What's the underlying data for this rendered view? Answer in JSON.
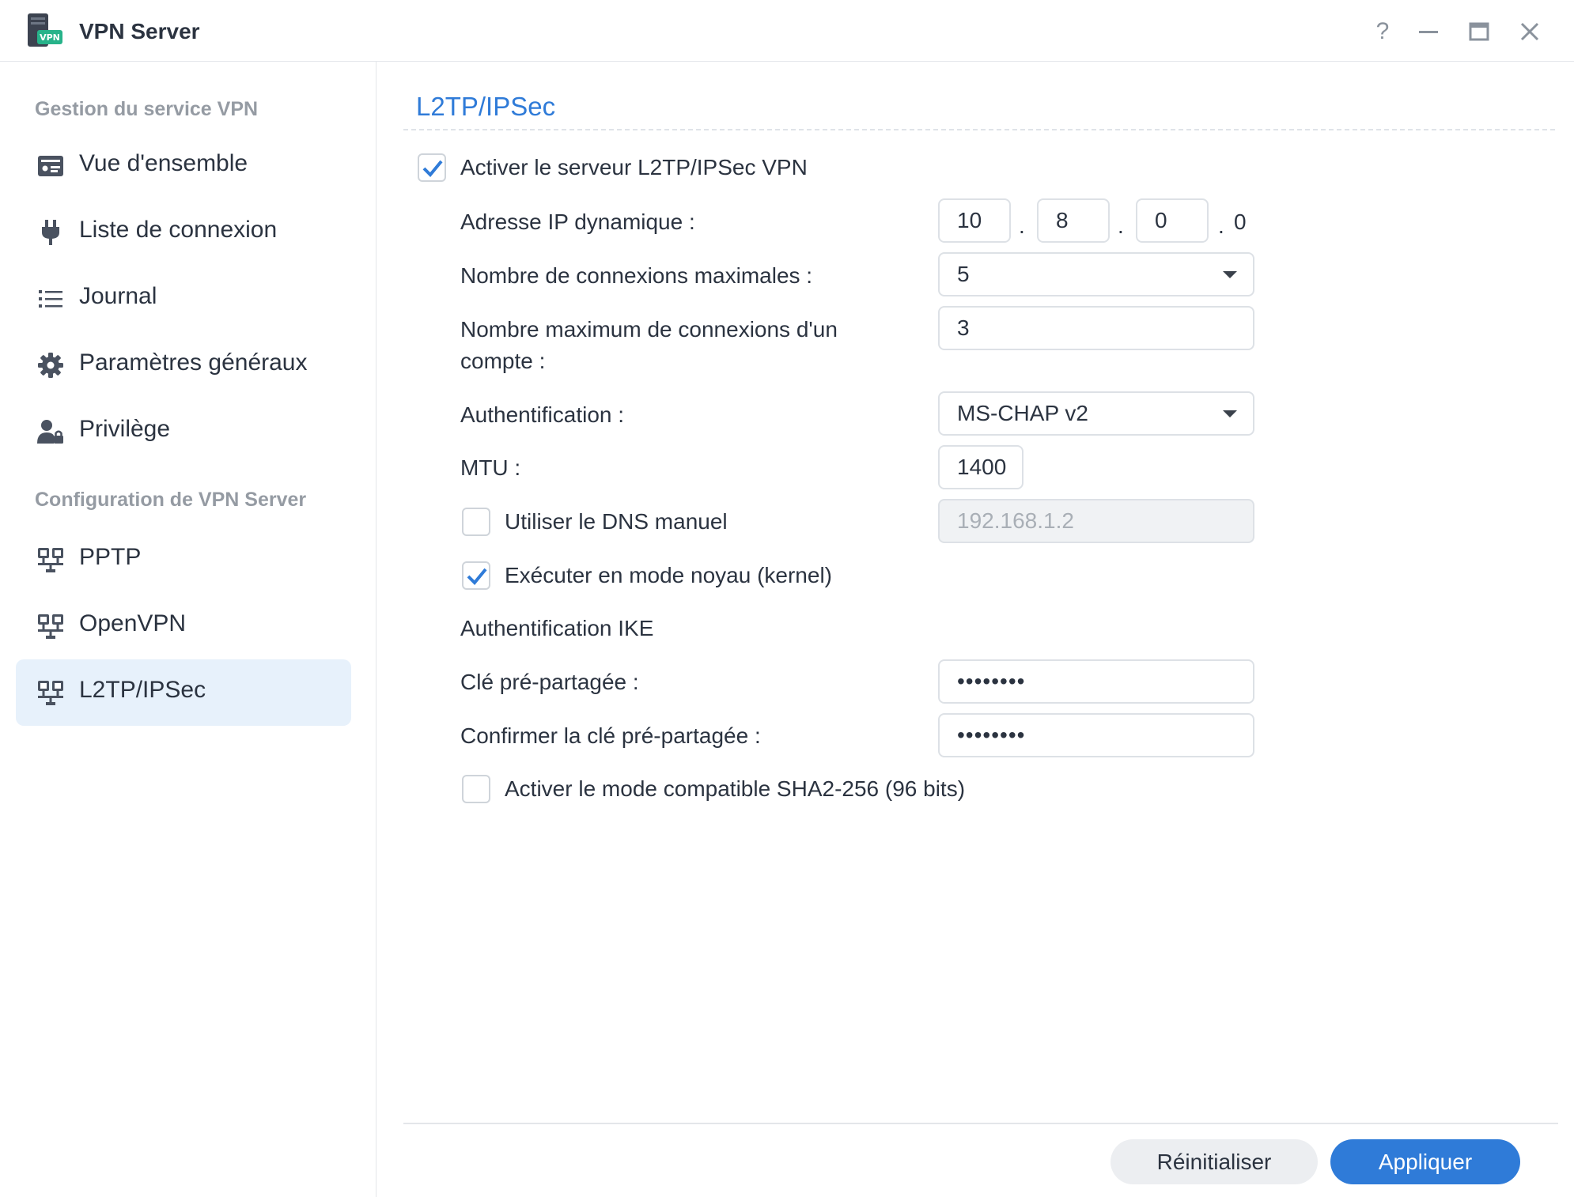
{
  "window": {
    "title": "VPN Server",
    "help_glyph": "?",
    "icons": [
      "app-icon-vpn",
      "help-icon",
      "minimize-icon",
      "maximize-icon",
      "close-icon"
    ]
  },
  "sidebar": {
    "heading_service": "Gestion du service VPN",
    "heading_config": "Configuration de VPN Server",
    "items": [
      {
        "label": "Vue d'ensemble",
        "icon": "overview-card-icon"
      },
      {
        "label": "Liste de connexion",
        "icon": "plug-icon"
      },
      {
        "label": "Journal",
        "icon": "list-icon"
      },
      {
        "label": "Paramètres généraux",
        "icon": "gear-icon"
      },
      {
        "label": "Privilège",
        "icon": "user-lock-icon"
      },
      {
        "label": "PPTP",
        "icon": "network-icon"
      },
      {
        "label": "OpenVPN",
        "icon": "network-icon"
      },
      {
        "label": "L2TP/IPSec",
        "icon": "network-icon",
        "active": true
      }
    ],
    "active_color": "#e7f1fb"
  },
  "main": {
    "title": "L2TP/IPSec",
    "accent": "#2f7bd8",
    "enable_server": {
      "label": "Activer le serveur L2TP/IPSec VPN",
      "checked": true
    },
    "dynamic_ip": {
      "label": "Adresse IP dynamique :",
      "octets": [
        "10",
        "8",
        "0",
        "0"
      ],
      "sep": "."
    },
    "max_connections": {
      "label": "Nombre de connexions maximales :",
      "value": "5"
    },
    "max_per_account": {
      "label_line1": "Nombre maximum de connexions d'un",
      "label_line2": "compte :",
      "value": "3"
    },
    "authentication": {
      "label": "Authentification :",
      "value": "MS-CHAP v2"
    },
    "mtu": {
      "label": "MTU :",
      "value": "1400"
    },
    "manual_dns": {
      "label": "Utiliser le DNS manuel",
      "checked": false,
      "value": "192.168.1.2"
    },
    "kernel_mode": {
      "label": "Exécuter en mode noyau (kernel)",
      "checked": true
    },
    "ike_heading": "Authentification IKE",
    "psk": {
      "label": "Clé pré-partagée :",
      "value": "••••••••"
    },
    "psk_confirm": {
      "label": "Confirmer la clé pré-partagée :",
      "value": "••••••••"
    },
    "sha2": {
      "label": "Activer le mode compatible SHA2-256 (96 bits)",
      "checked": false
    }
  },
  "footer": {
    "reset_label": "Réinitialiser",
    "apply_label": "Appliquer"
  }
}
